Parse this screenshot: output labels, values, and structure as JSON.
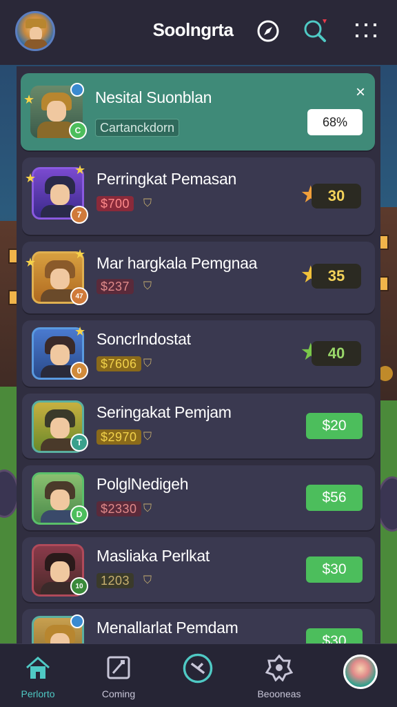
{
  "header": {
    "title": "Soolngrta",
    "icons": [
      "compass-icon",
      "search-icon",
      "more-icon"
    ],
    "notification_color": "#e83a4a"
  },
  "featured": {
    "title": "Nesital Suonblan",
    "subtitle": "Cartanckdorn",
    "percent": "68%",
    "close_label": "×"
  },
  "items": [
    {
      "title": "Perringkat Pemasan",
      "price": "$700",
      "score": "30",
      "badge": "7",
      "star_color": "#f2a03a"
    },
    {
      "title": "Mar hargkala Pemgnaa",
      "price": "$237",
      "score": "35",
      "badge": "47",
      "star_color": "#f2c23a"
    },
    {
      "title": "Soncrlndostat",
      "price": "$7606",
      "score": "40",
      "badge": "0",
      "star_color": "#7ac84a"
    },
    {
      "title": "Seringakat Pemjam",
      "price": "$2970",
      "button": "$20",
      "badge": "T"
    },
    {
      "title": "PolglNedigeh",
      "price": "$2330",
      "button": "$56",
      "badge": "D"
    },
    {
      "title": "Masliaka Perlkat",
      "price": "1203",
      "button": "$30",
      "badge": "10"
    },
    {
      "title": "Menallarlat Pemdam",
      "price": "",
      "button": "$30",
      "badge": ""
    }
  ],
  "nav": {
    "home_label": "Perlorto",
    "coming_label": "Coming",
    "compass_label": "",
    "rewards_label": "Beooneas"
  },
  "colors": {
    "accent": "#4fc9c4",
    "featured_bg": "#3f8a78",
    "price_button": "#4cbe5c"
  }
}
